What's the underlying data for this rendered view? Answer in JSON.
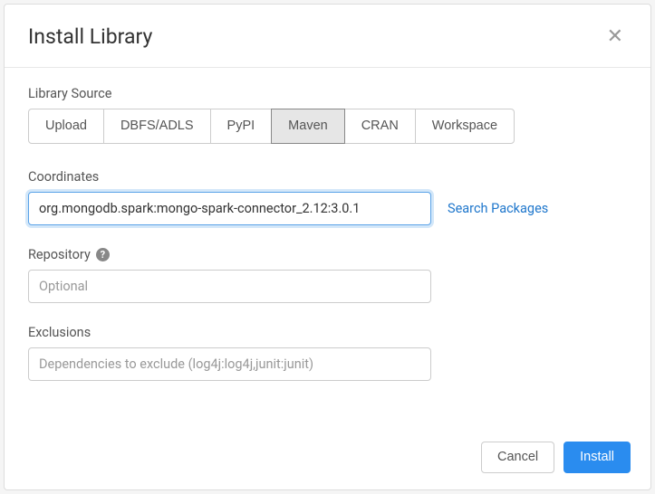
{
  "modal": {
    "title": "Install Library"
  },
  "librarySource": {
    "label": "Library Source",
    "options": [
      "Upload",
      "DBFS/ADLS",
      "PyPI",
      "Maven",
      "CRAN",
      "Workspace"
    ],
    "selected": "Maven"
  },
  "coordinates": {
    "label": "Coordinates",
    "value": "org.mongodb.spark:mongo-spark-connector_2.12:3.0.1",
    "searchLink": "Search Packages"
  },
  "repository": {
    "label": "Repository",
    "placeholder": "Optional",
    "value": ""
  },
  "exclusions": {
    "label": "Exclusions",
    "placeholder": "Dependencies to exclude (log4j:log4j,junit:junit)",
    "value": ""
  },
  "footer": {
    "cancel": "Cancel",
    "install": "Install"
  }
}
